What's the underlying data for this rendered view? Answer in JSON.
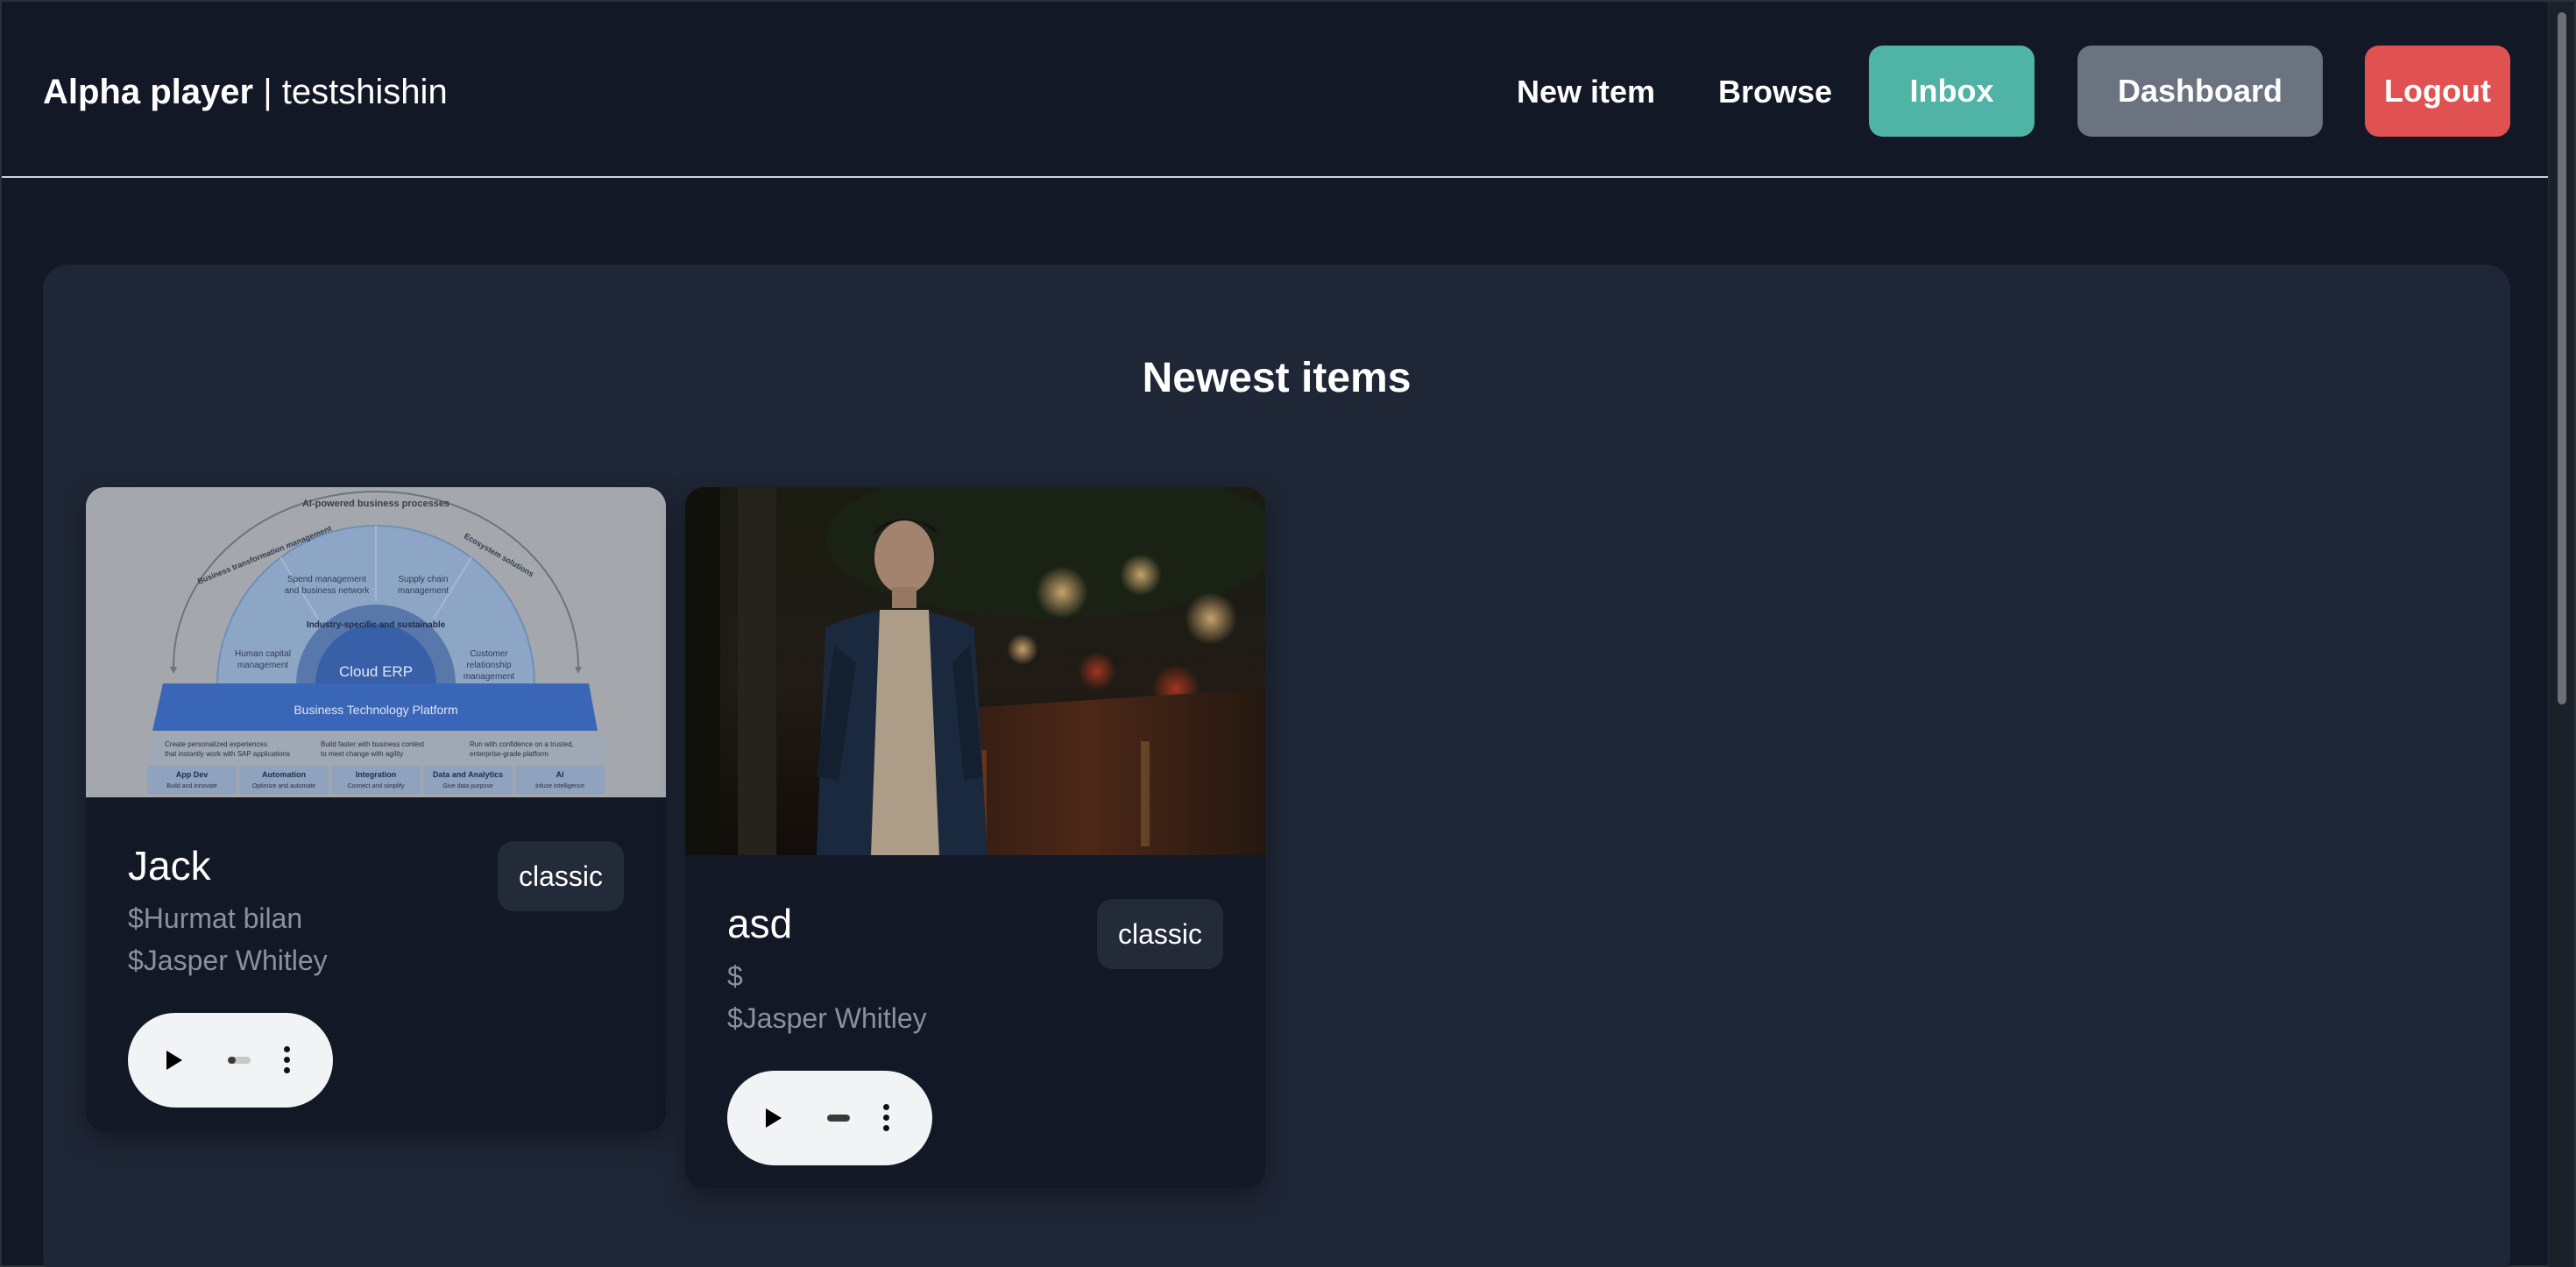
{
  "header": {
    "app_name": "Alpha player",
    "separator": " | ",
    "username": "testshishin",
    "nav": {
      "new_item": "New item",
      "browse": "Browse",
      "inbox": "Inbox",
      "dashboard": "Dashboard",
      "logout": "Logout"
    }
  },
  "main": {
    "section_title": "Newest items",
    "items": [
      {
        "title": "Jack",
        "line1": "$Hurmat bilan",
        "line2": "$Jasper Whitley",
        "badge": "classic",
        "progress": 0.35,
        "thumbnail": {
          "type": "diagram",
          "arc_label": "AI-powered business processes",
          "left_label": "Business transformation management",
          "right_label": "Ecosystem solutions",
          "spend": [
            "Spend management",
            "and business network"
          ],
          "supply": [
            "Supply chain",
            "management"
          ],
          "human": [
            "Human capital",
            "management"
          ],
          "customer": [
            "Customer",
            "relationship",
            "management"
          ],
          "industry": "Industry-specific and sustainable",
          "core": "Cloud ERP",
          "platform": "Business Technology Platform",
          "notes": [
            [
              "Create personalized experiences",
              "that instantly work with SAP applications"
            ],
            [
              "Build faster with business context",
              "to meet change with agility"
            ],
            [
              "Run with confidence on a trusted,",
              "enterprise-grade platform"
            ]
          ],
          "tiles": [
            {
              "title": "App Dev",
              "sub": "Build and innovate"
            },
            {
              "title": "Automation",
              "sub": "Optimize and automate"
            },
            {
              "title": "Integration",
              "sub": "Connect and simplify"
            },
            {
              "title": "Data and Analytics",
              "sub": "Give data purpose"
            },
            {
              "title": "AI",
              "sub": "Infuse intelligence"
            }
          ]
        }
      },
      {
        "title": "asd",
        "line1": "$",
        "line2": "$Jasper Whitley",
        "badge": "classic",
        "progress": 1.0,
        "thumbnail": {
          "type": "photo"
        }
      }
    ]
  },
  "colors": {
    "background": "#121826",
    "panel": "#1f2635",
    "inbox": "#4fb3a5",
    "dashboard": "#6b7280",
    "logout": "#e05251"
  }
}
